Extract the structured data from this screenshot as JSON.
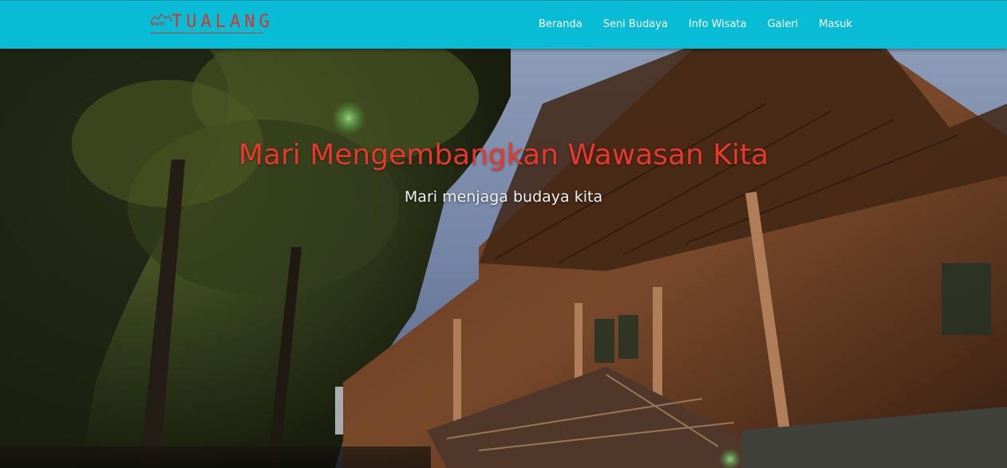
{
  "brand": {
    "small_text": "MARI",
    "name": "TUALANG",
    "color": "#d9342b"
  },
  "navbar": {
    "background": "#09bcd6",
    "items": [
      {
        "label": "Beranda"
      },
      {
        "label": "Seni Budaya"
      },
      {
        "label": "Info Wisata"
      },
      {
        "label": "Galeri"
      },
      {
        "label": "Masuk"
      }
    ]
  },
  "hero": {
    "title": "Mari Mengembangkan Wawasan Kita",
    "subtitle": "Mari menjaga budaya kita",
    "title_color": "#e8382e",
    "image_description_icon": "traditional-house-photo"
  }
}
